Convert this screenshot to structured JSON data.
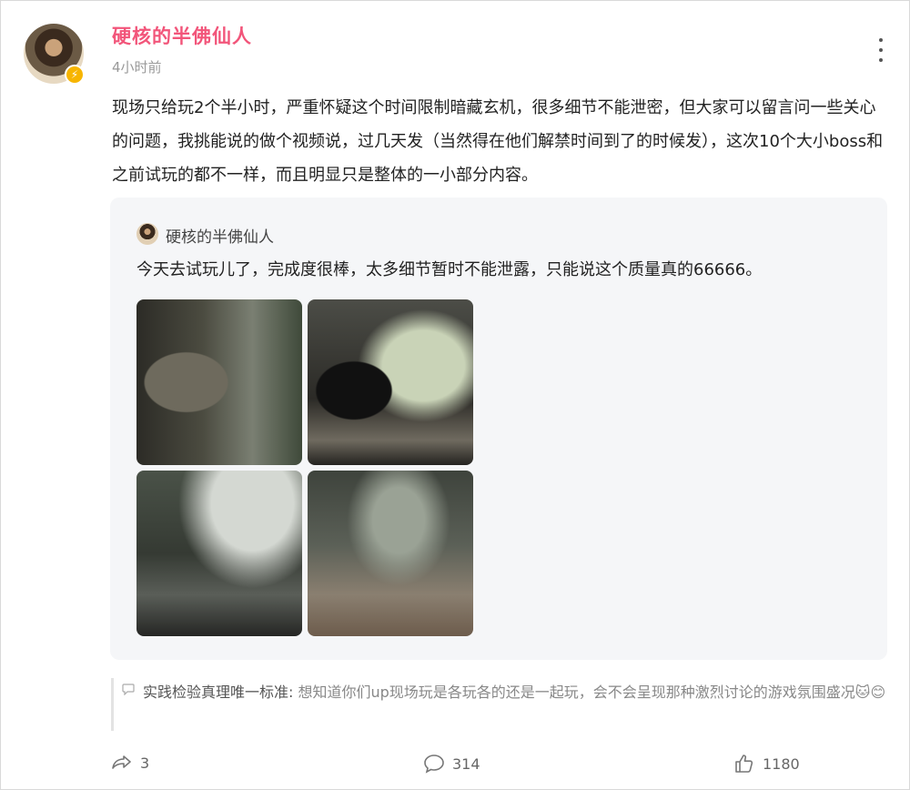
{
  "post": {
    "author": "硬核的半佛仙人",
    "time": "4小时前",
    "text": "现场只给玩2个半小时，严重怀疑这个时间限制暗藏玄机，很多细节不能泄密，但大家可以留言问一些关心的问题，我挑能说的做个视频说，过几天发（当然得在他们解禁时间到了的时候发），这次10个大小boss和之前试玩的都不一样，而且明显只是整体的一小部分内容。"
  },
  "quote": {
    "author": "硬核的半佛仙人",
    "text": "今天去试玩儿了，完成度很棒，太多细节暂时不能泄露，只能说这个质量真的66666。",
    "images": [
      "forest-statue-image",
      "cave-silhouette-image",
      "rocky-forest-image",
      "forest-path-image"
    ]
  },
  "comment": {
    "user": "实践检验真理唯一标准:",
    "text": " 想知道你们up现场玩是各玩各的还是一起玩，会不会呈现那种激烈讨论的游戏氛围盛况",
    "emoji": "🐱😊"
  },
  "footer": {
    "shares": "3",
    "replies": "314",
    "likes": "1180"
  },
  "colors": {
    "author": "#f2557a",
    "badge": "#f7b500",
    "card_bg": "#f5f6f8"
  }
}
